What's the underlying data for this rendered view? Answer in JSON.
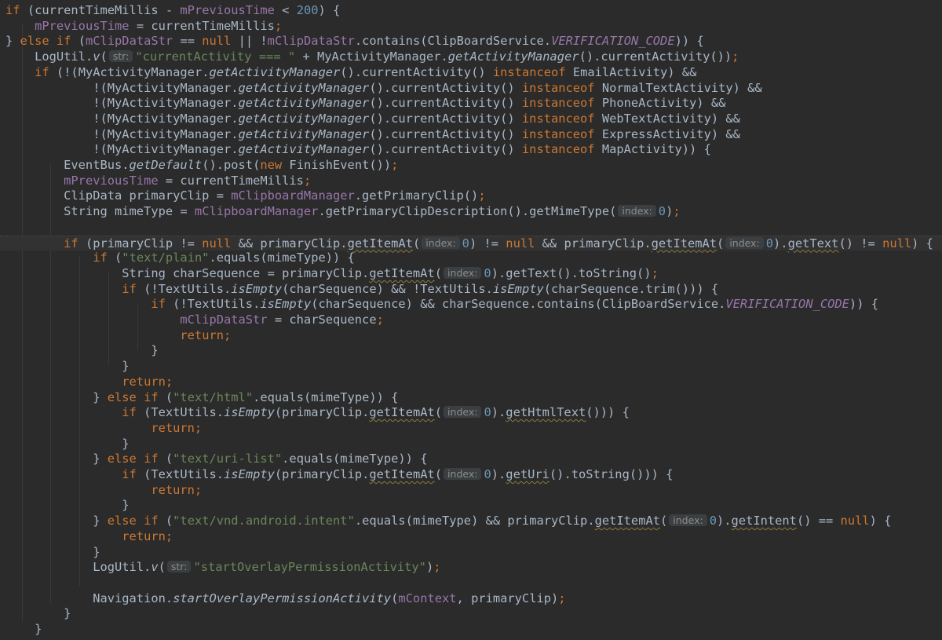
{
  "editor": {
    "language": "Java",
    "theme": "Darcula",
    "highlighted_line": 15,
    "colors": {
      "background": "#2b2b2b",
      "text": "#a9b7c6",
      "keyword": "#cc7832",
      "field": "#9876aa",
      "number": "#6897bb",
      "string": "#6a8759",
      "hint_background": "#3b3f41",
      "hint_text": "#8c8c8c"
    },
    "lines": [
      [
        [
          "kw",
          "if"
        ],
        [
          "t",
          " (currentTimeMillis - "
        ],
        [
          "fld",
          "mPreviousTime"
        ],
        [
          "t",
          " < "
        ],
        [
          "num",
          "200"
        ],
        [
          "t",
          ") {"
        ]
      ],
      [
        [
          "t",
          "    "
        ],
        [
          "fld",
          "mPreviousTime"
        ],
        [
          "t",
          " = currentTimeMillis"
        ],
        [
          "kw",
          ";"
        ]
      ],
      [
        [
          "t",
          "} "
        ],
        [
          "kw",
          "else if"
        ],
        [
          "t",
          " ("
        ],
        [
          "fld",
          "mClipDataStr"
        ],
        [
          "t",
          " == "
        ],
        [
          "kw",
          "null"
        ],
        [
          "t",
          " || !"
        ],
        [
          "fld",
          "mClipDataStr"
        ],
        [
          "t",
          ".contains(ClipBoardService."
        ],
        [
          "cst",
          "VERIFICATION_CODE"
        ],
        [
          "t",
          ")) {"
        ]
      ],
      [
        [
          "t",
          "    LogUtil."
        ],
        [
          "it",
          "v"
        ],
        [
          "t",
          "("
        ],
        [
          "hint",
          "str:"
        ],
        [
          "str",
          "\"currentActivity === \""
        ],
        [
          "t",
          " + MyActivityManager."
        ],
        [
          "it",
          "getActivityManager"
        ],
        [
          "t",
          "().currentActivity())"
        ],
        [
          "kw",
          ";"
        ]
      ],
      [
        [
          "t",
          "    "
        ],
        [
          "kw",
          "if"
        ],
        [
          "t",
          " (!(MyActivityManager."
        ],
        [
          "it",
          "getActivityManager"
        ],
        [
          "t",
          "().currentActivity() "
        ],
        [
          "kw",
          "instanceof"
        ],
        [
          "t",
          " EmailActivity) &&"
        ]
      ],
      [
        [
          "t",
          "            !(MyActivityManager."
        ],
        [
          "it",
          "getActivityManager"
        ],
        [
          "t",
          "().currentActivity() "
        ],
        [
          "kw",
          "instanceof"
        ],
        [
          "t",
          " NormalTextActivity) &&"
        ]
      ],
      [
        [
          "t",
          "            !(MyActivityManager."
        ],
        [
          "it",
          "getActivityManager"
        ],
        [
          "t",
          "().currentActivity() "
        ],
        [
          "kw",
          "instanceof"
        ],
        [
          "t",
          " PhoneActivity) &&"
        ]
      ],
      [
        [
          "t",
          "            !(MyActivityManager."
        ],
        [
          "it",
          "getActivityManager"
        ],
        [
          "t",
          "().currentActivity() "
        ],
        [
          "kw",
          "instanceof"
        ],
        [
          "t",
          " WebTextActivity) &&"
        ]
      ],
      [
        [
          "t",
          "            !(MyActivityManager."
        ],
        [
          "it",
          "getActivityManager"
        ],
        [
          "t",
          "().currentActivity() "
        ],
        [
          "kw",
          "instanceof"
        ],
        [
          "t",
          " ExpressActivity) &&"
        ]
      ],
      [
        [
          "t",
          "            !(MyActivityManager."
        ],
        [
          "it",
          "getActivityManager"
        ],
        [
          "t",
          "().currentActivity() "
        ],
        [
          "kw",
          "instanceof"
        ],
        [
          "t",
          " MapActivity)) {"
        ]
      ],
      [
        [
          "t",
          "        EventBus."
        ],
        [
          "it",
          "getDefault"
        ],
        [
          "t",
          "().post("
        ],
        [
          "kw",
          "new"
        ],
        [
          "t",
          " FinishEvent())"
        ],
        [
          "kw",
          ";"
        ]
      ],
      [
        [
          "t",
          "        "
        ],
        [
          "fld",
          "mPreviousTime"
        ],
        [
          "t",
          " = currentTimeMillis"
        ],
        [
          "kw",
          ";"
        ]
      ],
      [
        [
          "t",
          "        ClipData primaryClip = "
        ],
        [
          "fld",
          "mClipboardManager"
        ],
        [
          "t",
          ".getPrimaryClip()"
        ],
        [
          "kw",
          ";"
        ]
      ],
      [
        [
          "t",
          "        String mimeType = "
        ],
        [
          "fld",
          "mClipboardManager"
        ],
        [
          "t",
          ".getPrimaryClipDescription().getMimeType("
        ],
        [
          "hint",
          "index:"
        ],
        [
          "num",
          "0"
        ],
        [
          "t",
          ")"
        ],
        [
          "kw",
          ";"
        ]
      ],
      [
        [
          "t",
          ""
        ]
      ],
      [
        [
          "t",
          "        "
        ],
        [
          "kw",
          "if"
        ],
        [
          "t",
          " (primaryClip != "
        ],
        [
          "kw",
          "null"
        ],
        [
          "t",
          " && primaryClip."
        ],
        [
          "wavy",
          "getItemAt"
        ],
        [
          "t",
          "("
        ],
        [
          "hint",
          "index:"
        ],
        [
          "num",
          "0"
        ],
        [
          "t",
          ") != "
        ],
        [
          "kw",
          "null"
        ],
        [
          "t",
          " && primaryClip."
        ],
        [
          "wavy",
          "getItemAt"
        ],
        [
          "t",
          "("
        ],
        [
          "hint",
          "index:"
        ],
        [
          "num",
          "0"
        ],
        [
          "t",
          ")."
        ],
        [
          "wavy",
          "getText"
        ],
        [
          "t",
          "() != "
        ],
        [
          "kw",
          "null"
        ],
        [
          "t",
          ") {"
        ]
      ],
      [
        [
          "t",
          "            "
        ],
        [
          "kw",
          "if"
        ],
        [
          "t",
          " ("
        ],
        [
          "str",
          "\"text/plain\""
        ],
        [
          "t",
          ".equals(mimeType)) {"
        ]
      ],
      [
        [
          "t",
          "                String charSequence = primaryClip."
        ],
        [
          "wavy",
          "getItemAt"
        ],
        [
          "t",
          "("
        ],
        [
          "hint",
          "index:"
        ],
        [
          "num",
          "0"
        ],
        [
          "t",
          ").getText().toString()"
        ],
        [
          "kw",
          ";"
        ]
      ],
      [
        [
          "t",
          "                "
        ],
        [
          "kw",
          "if"
        ],
        [
          "t",
          " (!TextUtils."
        ],
        [
          "it",
          "isEmpty"
        ],
        [
          "t",
          "(charSequence) && !TextUtils."
        ],
        [
          "it",
          "isEmpty"
        ],
        [
          "t",
          "(charSequence.trim())) {"
        ]
      ],
      [
        [
          "t",
          "                    "
        ],
        [
          "kw",
          "if"
        ],
        [
          "t",
          " (!TextUtils."
        ],
        [
          "it",
          "isEmpty"
        ],
        [
          "t",
          "(charSequence) && charSequence.contains(ClipBoardService."
        ],
        [
          "cst",
          "VERIFICATION_CODE"
        ],
        [
          "t",
          ")) {"
        ]
      ],
      [
        [
          "t",
          "                        "
        ],
        [
          "fld",
          "mClipDataStr"
        ],
        [
          "t",
          " = charSequence"
        ],
        [
          "kw",
          ";"
        ]
      ],
      [
        [
          "t",
          "                        "
        ],
        [
          "kw",
          "return;"
        ]
      ],
      [
        [
          "t",
          "                    }"
        ]
      ],
      [
        [
          "t",
          "                }"
        ]
      ],
      [
        [
          "t",
          "                "
        ],
        [
          "kw",
          "return;"
        ]
      ],
      [
        [
          "t",
          "            } "
        ],
        [
          "kw",
          "else if"
        ],
        [
          "t",
          " ("
        ],
        [
          "str",
          "\"text/html\""
        ],
        [
          "t",
          ".equals(mimeType)) {"
        ]
      ],
      [
        [
          "t",
          "                "
        ],
        [
          "kw",
          "if"
        ],
        [
          "t",
          " (TextUtils."
        ],
        [
          "it",
          "isEmpty"
        ],
        [
          "t",
          "(primaryClip."
        ],
        [
          "wavy",
          "getItemAt"
        ],
        [
          "t",
          "("
        ],
        [
          "hint",
          "index:"
        ],
        [
          "num",
          "0"
        ],
        [
          "t",
          ")."
        ],
        [
          "wavy",
          "getHtmlText"
        ],
        [
          "t",
          "())) {"
        ]
      ],
      [
        [
          "t",
          "                    "
        ],
        [
          "kw",
          "return;"
        ]
      ],
      [
        [
          "t",
          "                }"
        ]
      ],
      [
        [
          "t",
          "            } "
        ],
        [
          "kw",
          "else if"
        ],
        [
          "t",
          " ("
        ],
        [
          "str",
          "\"text/uri-list\""
        ],
        [
          "t",
          ".equals(mimeType)) {"
        ]
      ],
      [
        [
          "t",
          "                "
        ],
        [
          "kw",
          "if"
        ],
        [
          "t",
          " (TextUtils."
        ],
        [
          "it",
          "isEmpty"
        ],
        [
          "t",
          "(primaryClip."
        ],
        [
          "wavy",
          "getItemAt"
        ],
        [
          "t",
          "("
        ],
        [
          "hint",
          "index:"
        ],
        [
          "num",
          "0"
        ],
        [
          "t",
          ")."
        ],
        [
          "wavy",
          "getUri"
        ],
        [
          "t",
          "().toString())) {"
        ]
      ],
      [
        [
          "t",
          "                    "
        ],
        [
          "kw",
          "return;"
        ]
      ],
      [
        [
          "t",
          "                }"
        ]
      ],
      [
        [
          "t",
          "            } "
        ],
        [
          "kw",
          "else if"
        ],
        [
          "t",
          " ("
        ],
        [
          "str",
          "\"text/vnd.android.intent\""
        ],
        [
          "t",
          ".equals(mimeType) && primaryClip."
        ],
        [
          "wavy",
          "getItemAt"
        ],
        [
          "t",
          "("
        ],
        [
          "hint",
          "index:"
        ],
        [
          "num",
          "0"
        ],
        [
          "t",
          ")."
        ],
        [
          "wavy",
          "getIntent"
        ],
        [
          "t",
          "() == "
        ],
        [
          "kw",
          "null"
        ],
        [
          "t",
          ") {"
        ]
      ],
      [
        [
          "t",
          "                "
        ],
        [
          "kw",
          "return;"
        ]
      ],
      [
        [
          "t",
          "            }"
        ]
      ],
      [
        [
          "t",
          "            LogUtil."
        ],
        [
          "it",
          "v"
        ],
        [
          "t",
          "("
        ],
        [
          "hint",
          "str:"
        ],
        [
          "str",
          "\"startOverlayPermissionActivity\""
        ],
        [
          "t",
          ")"
        ],
        [
          "kw",
          ";"
        ]
      ],
      [
        [
          "t",
          ""
        ]
      ],
      [
        [
          "t",
          "            Navigation."
        ],
        [
          "it",
          "startOverlayPermissionActivity"
        ],
        [
          "t",
          "("
        ],
        [
          "fld",
          "mContext"
        ],
        [
          "t",
          ", primaryClip)"
        ],
        [
          "kw",
          ";"
        ]
      ],
      [
        [
          "t",
          "        }"
        ]
      ],
      [
        [
          "t",
          "    }"
        ]
      ]
    ]
  }
}
